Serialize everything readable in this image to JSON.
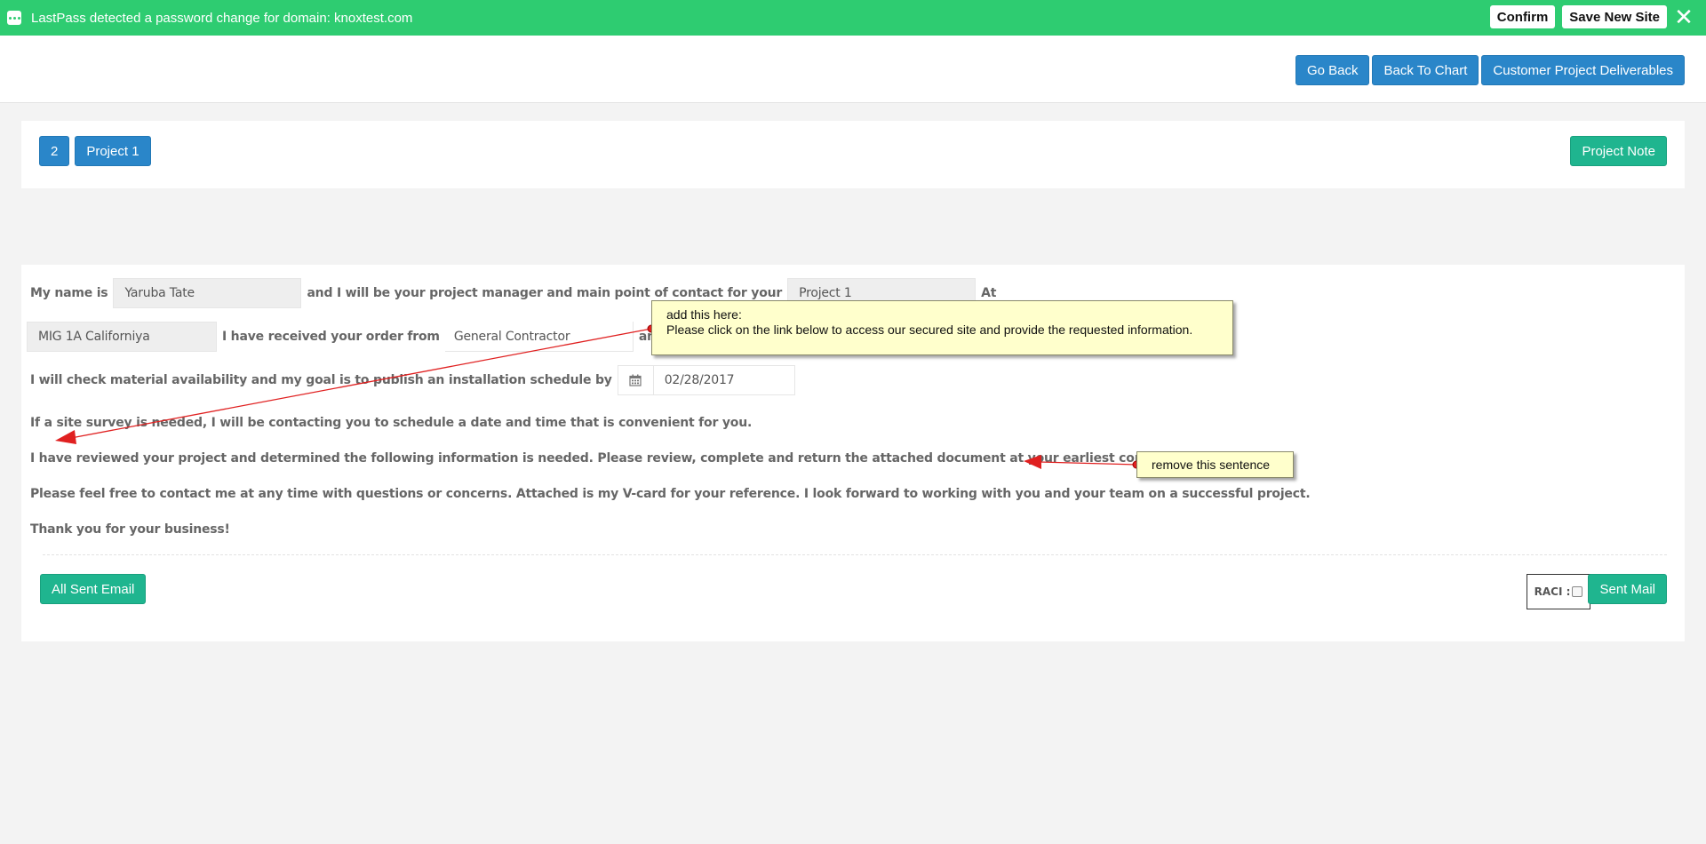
{
  "lastpass": {
    "message": "LastPass detected a password change for domain: knoxtest.com",
    "confirm_label": "Confirm",
    "save_label": "Save New Site",
    "close_glyph": "✕",
    "icon": "lastpass-dots-icon",
    "color": "#2ecc71"
  },
  "topnav": {
    "go_back": "Go Back",
    "back_to_chart": "Back To Chart",
    "deliverables": "Customer Project Deliverables"
  },
  "project": {
    "number": "2",
    "name": "Project 1",
    "note_label": "Project Note"
  },
  "letter": {
    "line1": {
      "prefix": "My name is",
      "manager_name": "Yaruba Tate",
      "middle": "and I will be your project manager and main point of contact for your",
      "project_value": "Project 1",
      "suffix": "At"
    },
    "line2": {
      "location_value": "MIG 1A Californiya",
      "middle": "I have received your order from",
      "contractor_value": "General Contractor",
      "suffix": "and will"
    },
    "line3": {
      "prefix": "I will check material availability and my goal is to publish an installation schedule by",
      "date_value": "02/28/2017"
    },
    "para1": "If a site survey is needed, I will be contacting you to schedule a date and time that is convenient for you.",
    "para2": "I have reviewed your project and determined the following information is needed. Please review, complete and return the attached document at your earliest convenience.",
    "para3": "Please feel free to contact me at any time with questions or concerns. Attached is my V-card for your reference. I look forward to working with you and your team on a successful project.",
    "para4": "Thank you for your business!"
  },
  "actions": {
    "all_sent_email": "All Sent Email",
    "raci_label": "RACI :",
    "sent_mail": "Sent Mail"
  },
  "annotations": {
    "note1_title": "add this here:",
    "note1_body": "Please click on the link below to access our secured site and provide the requested information.",
    "note2": "remove this sentence",
    "arrow_color": "#e02020"
  },
  "colors": {
    "primary_blue": "#2a86c9",
    "teal": "#1fb58f",
    "note_bg": "#ffffcc"
  }
}
